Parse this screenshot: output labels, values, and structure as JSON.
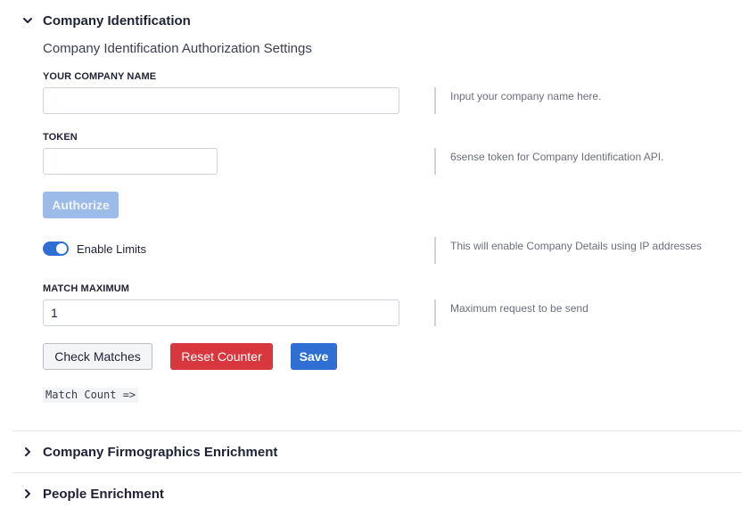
{
  "sections": {
    "company_identification": {
      "title": "Company Identification",
      "subtitle": "Company Identification Authorization Settings",
      "company_name": {
        "label": "YOUR COMPANY NAME",
        "value": "",
        "help": "Input your company name here."
      },
      "token": {
        "label": "TOKEN",
        "value": "",
        "help": "6sense token for Company Identification API."
      },
      "authorize_label": "Authorize",
      "enable_limits": {
        "label": "Enable Limits",
        "enabled": true,
        "help": "This will enable Company Details using IP addresses"
      },
      "match_maximum": {
        "label": "MATCH MAXIMUM",
        "value": "1",
        "help": "Maximum request to be send"
      },
      "buttons": {
        "check_matches": "Check Matches",
        "reset_counter": "Reset Counter",
        "save": "Save"
      },
      "match_count": "Match Count =>"
    },
    "firmographics": {
      "title": "Company Firmographics Enrichment"
    },
    "people": {
      "title": "People Enrichment"
    }
  },
  "colors": {
    "primary": "#2f6fd4",
    "danger": "#d8373e",
    "disabled_primary": "#9cbbe9",
    "text": "#1f2235",
    "muted": "#6b6f7b"
  },
  "icons": {
    "expanded": "chevron-down-icon",
    "collapsed": "chevron-right-icon"
  }
}
